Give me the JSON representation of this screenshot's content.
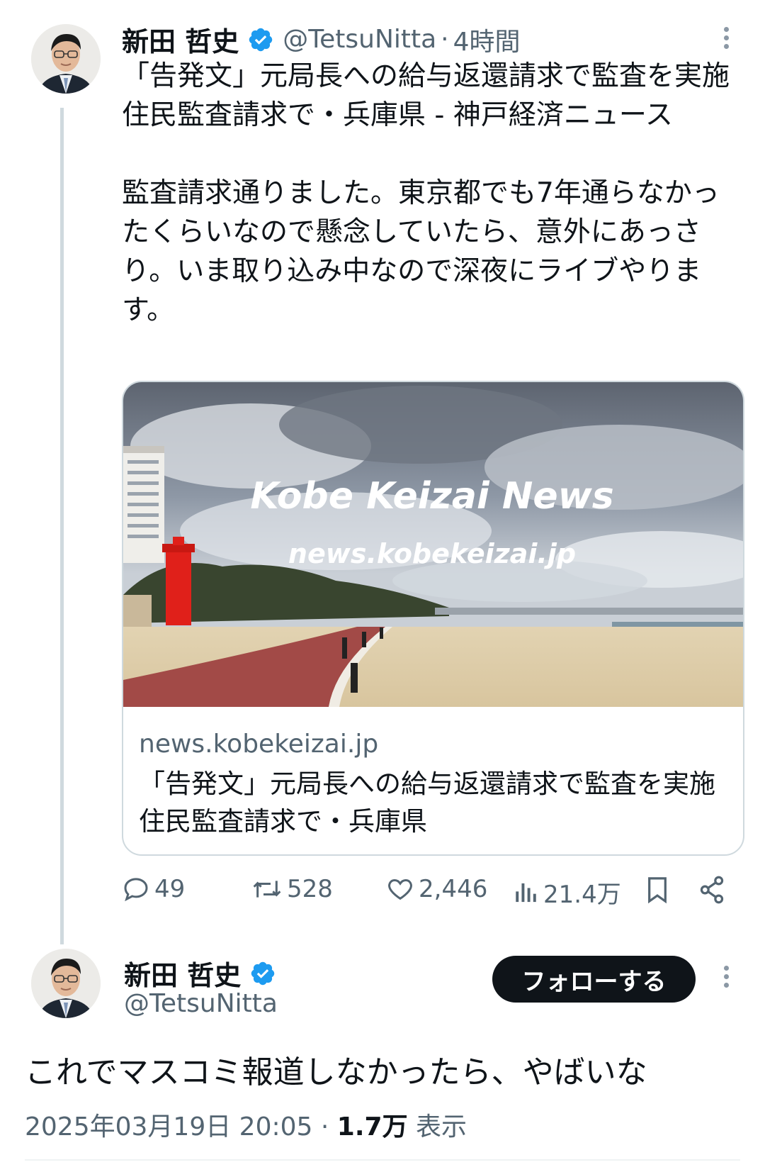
{
  "tweet": {
    "author_name": "新田 哲史",
    "handle": "@TetsuNitta",
    "time": "4時間",
    "separator": "·",
    "text": "「告発文」元局長への給与返還請求で監査を実施　住民監査請求で・兵庫県 - 神戸経済ニュース\n\n監査請求通りました。東京都でも7年通らなかったくらいなので懸念していたら、意外にあっさり。いま取り込み中なので深夜にライブやります。",
    "card": {
      "image_title": "Kobe Keizai News",
      "image_subtitle": "news.kobekeizai.jp",
      "domain": "news.kobekeizai.jp",
      "title": "「告発文」元局長への給与返還請求で監査を実施　住民監査請求で・兵庫県"
    },
    "actions": {
      "replies": "49",
      "retweets": "528",
      "likes": "2,446",
      "views": "21.4万"
    }
  },
  "reply": {
    "author_name": "新田 哲史",
    "handle": "@TetsuNitta",
    "follow_label": "フォローする",
    "text": "これでマスコミ報道しなかったら、やばいな",
    "date": "2025年03月19日 20:05",
    "separator": "·",
    "views_count": "1.7万",
    "views_label": "表示"
  },
  "colors": {
    "verified": "#1d9bf0",
    "text": "#0f1419",
    "secondary": "#536471",
    "follow_button": "#0f1419"
  }
}
